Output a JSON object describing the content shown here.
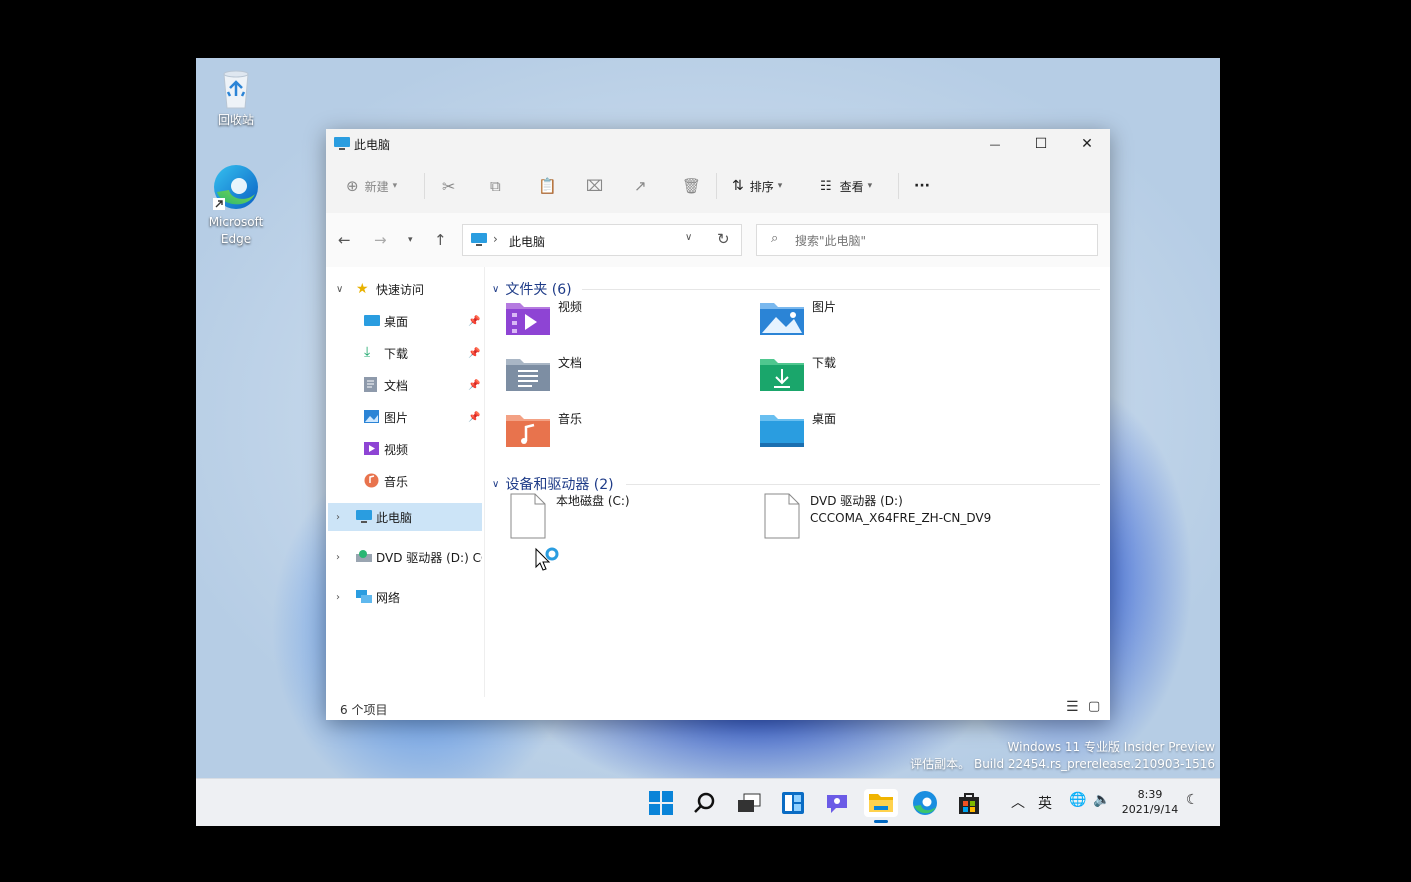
{
  "desktop": {
    "icons": [
      {
        "label": "回收站"
      },
      {
        "label": "Microsoft\nEdge",
        "line1": "Microsoft",
        "line2": "Edge"
      }
    ]
  },
  "window": {
    "title": "此电脑",
    "controls": {
      "minimize": "—",
      "maximize": "☐",
      "close": "✕"
    }
  },
  "toolbar": {
    "new_label": "新建",
    "sort_label": "排序",
    "view_label": "查看",
    "more_label": "···"
  },
  "nav": {
    "address": "此电脑",
    "search_placeholder": "搜索\"此电脑\""
  },
  "sidebar": {
    "quick_access": "快速访问",
    "items": [
      {
        "label": "桌面",
        "pinned": true
      },
      {
        "label": "下载",
        "pinned": true
      },
      {
        "label": "文档",
        "pinned": true
      },
      {
        "label": "图片",
        "pinned": true
      },
      {
        "label": "视频",
        "pinned": false
      },
      {
        "label": "音乐",
        "pinned": false
      }
    ],
    "this_pc": "此电脑",
    "dvd": "DVD 驱动器 (D:) CC",
    "network": "网络"
  },
  "content": {
    "folders_header": "文件夹 (6)",
    "folders": [
      {
        "label": "视频",
        "icon": "video-folder-icon",
        "color": "#8e44d4"
      },
      {
        "label": "图片",
        "icon": "pictures-folder-icon",
        "color": "#2b84d6"
      },
      {
        "label": "文档",
        "icon": "documents-folder-icon",
        "color": "#7d8ea3"
      },
      {
        "label": "下载",
        "icon": "downloads-folder-icon",
        "color": "#1aa66b"
      },
      {
        "label": "音乐",
        "icon": "music-folder-icon",
        "color": "#e8734d"
      },
      {
        "label": "桌面",
        "icon": "desktop-folder-icon",
        "color": "#2a9de0"
      }
    ],
    "drives_header": "设备和驱动器 (2)",
    "drives": [
      {
        "label": "本地磁盘 (C:)",
        "sublabel": ""
      },
      {
        "label": "DVD 驱动器 (D:)",
        "sublabel": "CCCOMA_X64FRE_ZH-CN_DV9"
      }
    ]
  },
  "status": {
    "count": "6 个项目"
  },
  "watermark": {
    "line1": "Windows 11 专业版 Insider Preview",
    "line2": "评估副本。 Build 22454.rs_prerelease.210903-1516"
  },
  "taskbar": {
    "ime": "英",
    "time": "8:39",
    "date": "2021/9/14"
  },
  "colors": {
    "accent": "#0067c0",
    "selected": "#cce4f7",
    "section_header": "#1f3c88"
  }
}
